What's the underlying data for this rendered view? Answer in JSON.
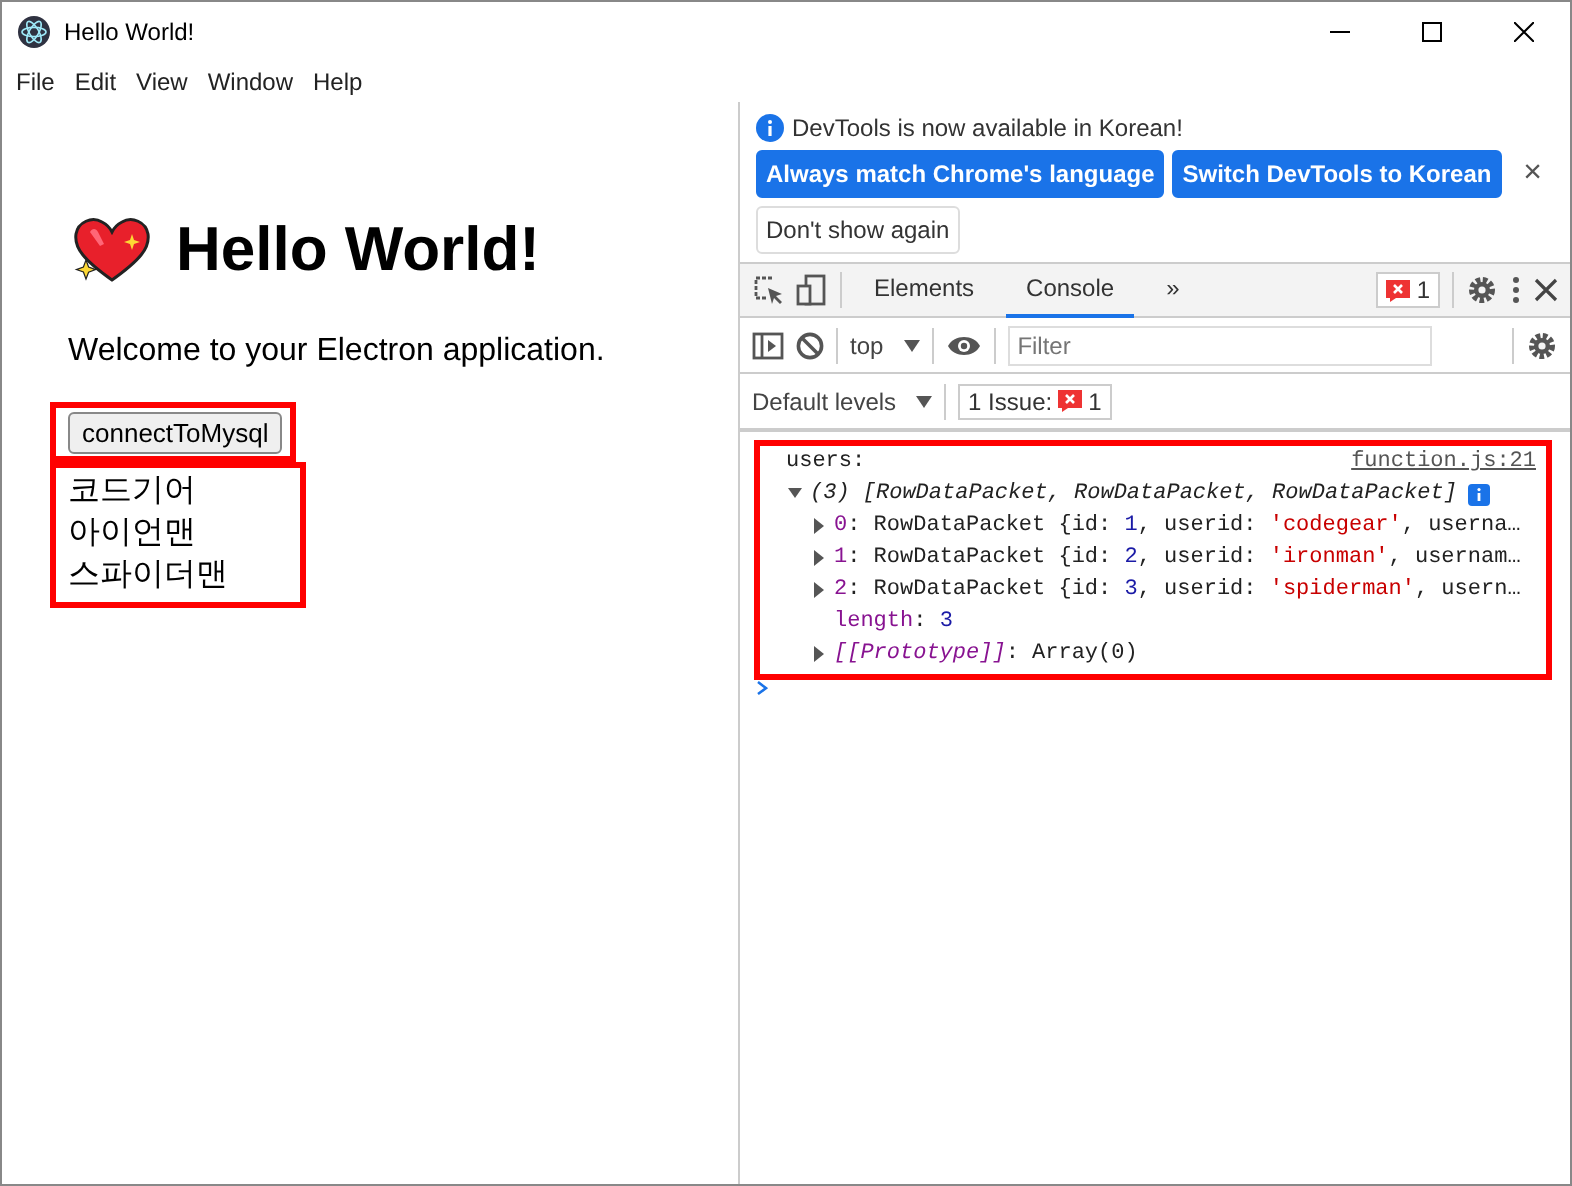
{
  "window": {
    "title": "Hello World!"
  },
  "menu": [
    "File",
    "Edit",
    "View",
    "Window",
    "Help"
  ],
  "app": {
    "heading": "Hello World!",
    "welcome": "Welcome to your Electron application.",
    "button": "connectToMysql",
    "users": [
      "코드기어",
      "아이언맨",
      "스파이더맨"
    ]
  },
  "devtools": {
    "infobar": {
      "message": "DevTools is now available in Korean!",
      "buttons": [
        {
          "label": "Always match Chrome's language",
          "kind": "primary"
        },
        {
          "label": "Switch DevTools to Korean",
          "kind": "primary"
        },
        {
          "label": "Don't show again",
          "kind": "secondary"
        }
      ],
      "close": "×"
    },
    "tabs": [
      {
        "label": "Elements",
        "selected": false
      },
      {
        "label": "Console",
        "selected": true
      }
    ],
    "more": "»",
    "error_count": "1",
    "context": "top",
    "filter": {
      "placeholder": "Filter"
    },
    "levels": "Default levels",
    "issues": "1 Issue:",
    "issue_count": "1",
    "log": {
      "label": "users:",
      "source": "function.js:21",
      "summary": "(3) [RowDataPacket, RowDataPacket, RowDataPacket]",
      "expanded": true,
      "entries": [
        {
          "expanded": false,
          "parts": [
            {
              "text": "0",
              "kind": "key"
            },
            {
              "text": ": RowDataPacket {id: ",
              "kind": "plain"
            },
            {
              "text": "1",
              "kind": "number"
            },
            {
              "text": ", userid: ",
              "kind": "plain"
            },
            {
              "text": "'codegear'",
              "kind": "string"
            },
            {
              "text": ", userna…",
              "kind": "plain"
            }
          ]
        },
        {
          "expanded": false,
          "parts": [
            {
              "text": "1",
              "kind": "key"
            },
            {
              "text": ": RowDataPacket {id: ",
              "kind": "plain"
            },
            {
              "text": "2",
              "kind": "number"
            },
            {
              "text": ", userid: ",
              "kind": "plain"
            },
            {
              "text": "'ironman'",
              "kind": "string"
            },
            {
              "text": ", usernam…",
              "kind": "plain"
            }
          ]
        },
        {
          "expanded": false,
          "parts": [
            {
              "text": "2",
              "kind": "key"
            },
            {
              "text": ": RowDataPacket {id: ",
              "kind": "plain"
            },
            {
              "text": "3",
              "kind": "number"
            },
            {
              "text": ", userid: ",
              "kind": "plain"
            },
            {
              "text": "'spiderman'",
              "kind": "string"
            },
            {
              "text": ", usern…",
              "kind": "plain"
            }
          ]
        },
        {
          "parts": [
            {
              "text": "length",
              "kind": "key"
            },
            {
              "text": ": ",
              "kind": "plain"
            },
            {
              "text": "3",
              "kind": "number"
            }
          ]
        },
        {
          "expanded": false,
          "parts": [
            {
              "text": "[[Prototype]]",
              "kind": "proto"
            },
            {
              "text": ": Array(0)",
              "kind": "plain"
            }
          ]
        }
      ]
    }
  }
}
